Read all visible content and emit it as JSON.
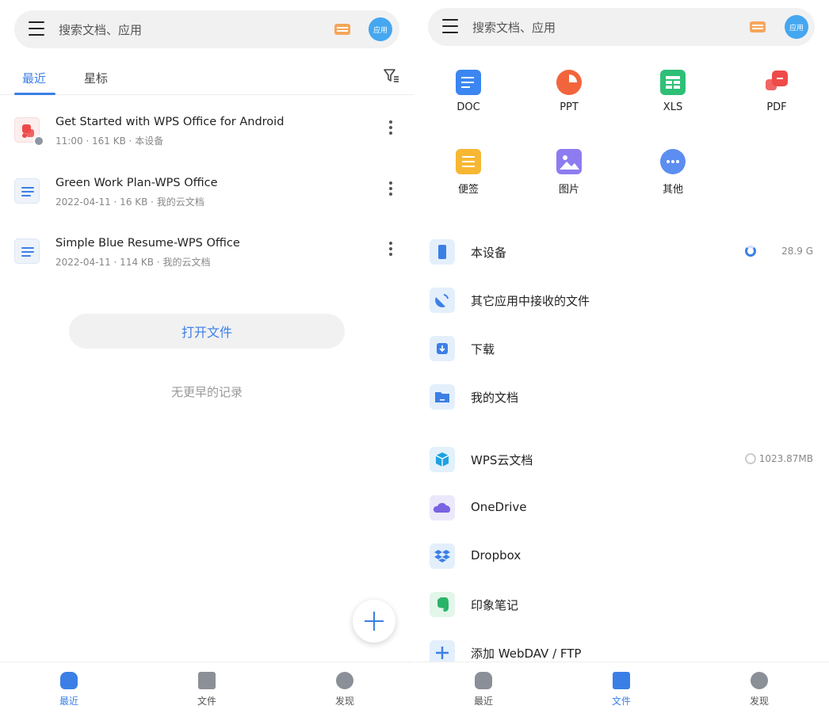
{
  "left": {
    "search": {
      "placeholder": "搜索文档、应用",
      "apps_label": "应用"
    },
    "tabs": [
      {
        "label": "最近"
      },
      {
        "label": "星标"
      }
    ],
    "files": [
      {
        "title": "Get Started with WPS Office for Android",
        "meta": "11:00 · 161 KB · 本设备",
        "type": "pdf"
      },
      {
        "title": "Green Work Plan-WPS Office",
        "meta": "2022-04-11 · 16 KB · 我的云文档",
        "type": "doc"
      },
      {
        "title": "Simple Blue Resume-WPS Office",
        "meta": "2022-04-11 · 114 KB · 我的云文档",
        "type": "doc"
      }
    ],
    "open_file_label": "打开文件",
    "no_more_label": "无更早的记录",
    "nav": [
      {
        "label": "最近"
      },
      {
        "label": "文件"
      },
      {
        "label": "发现"
      }
    ]
  },
  "right": {
    "search": {
      "placeholder": "搜索文档、应用",
      "apps_label": "应用"
    },
    "categories": [
      {
        "label": "DOC",
        "icon": "doc-icon",
        "color": "#3b86f0"
      },
      {
        "label": "PPT",
        "icon": "ppt-icon",
        "color": "#f2653c"
      },
      {
        "label": "XLS",
        "icon": "xls-icon",
        "color": "#2fbf77"
      },
      {
        "label": "PDF",
        "icon": "pdf-icon",
        "color": "#ef4a4a"
      },
      {
        "label": "便签",
        "icon": "note-icon",
        "color": "#f7b733"
      },
      {
        "label": "图片",
        "icon": "image-icon",
        "color": "#8d7cf0"
      },
      {
        "label": "其他",
        "icon": "more-icon",
        "color": "#5c8df0"
      }
    ],
    "locations": [
      {
        "label": "本设备",
        "usage": "28.9 G",
        "icon": "phone-icon"
      },
      {
        "label": "其它应用中接收的文件",
        "usage": "",
        "icon": "satellite-icon"
      },
      {
        "label": "下载",
        "usage": "",
        "icon": "download-icon"
      },
      {
        "label": "我的文档",
        "usage": "",
        "icon": "folder-icon"
      }
    ],
    "clouds": [
      {
        "label": "WPS云文档",
        "usage": "1023.87MB",
        "icon": "cube-icon"
      },
      {
        "label": "OneDrive",
        "usage": "",
        "icon": "cloud-icon"
      },
      {
        "label": "Dropbox",
        "usage": "",
        "icon": "dropbox-icon"
      },
      {
        "label": "印象笔记",
        "usage": "",
        "icon": "evernote-icon"
      },
      {
        "label": "添加 WebDAV / FTP",
        "usage": "",
        "icon": "plus-icon"
      }
    ],
    "nav": [
      {
        "label": "最近"
      },
      {
        "label": "文件"
      },
      {
        "label": "发现"
      }
    ]
  },
  "colors": {
    "accent": "#3b7fe6"
  }
}
